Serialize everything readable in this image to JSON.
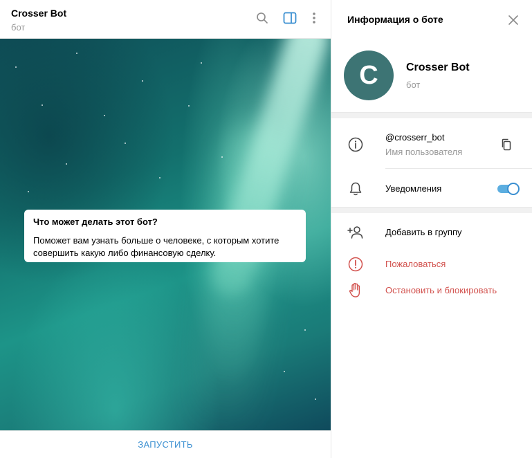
{
  "chat": {
    "title": "Crosser Bot",
    "subtitle": "бот",
    "icons": {
      "search": "search-icon",
      "sidebar": "sidebar-toggle-icon",
      "more": "more-vertical-icon"
    },
    "intro": {
      "title": "Что может делать этот бот?",
      "text": "Поможет вам узнать больше о человеке, с которым хотите совершить какую либо финансовую сделку."
    },
    "start_label": "ЗАПУСТИТЬ"
  },
  "info": {
    "title": "Информация о боте",
    "profile": {
      "avatar_letter": "C",
      "avatar_color": "#3d7474",
      "name": "Crosser Bot",
      "subtitle": "бот"
    },
    "username": {
      "value": "@crosserr_bot",
      "label": "Имя пользователя"
    },
    "notifications": {
      "label": "Уведомления",
      "enabled": true
    },
    "actions": {
      "add_to_group": "Добавить в группу",
      "report": "Пожаловаться",
      "stop_block": "Остановить и блокировать"
    }
  },
  "colors": {
    "accent": "#3a8fd1",
    "danger": "#d2524e",
    "muted": "#999999"
  }
}
